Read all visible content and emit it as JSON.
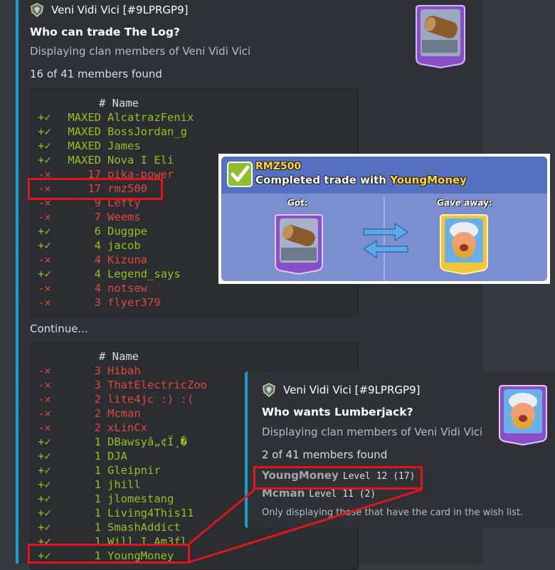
{
  "clan_embed": {
    "author": "Veni Vidi Vici [#9LPRGP9]",
    "title": "Who can trade The Log?",
    "description": "Displaying clan members of Veni Vidi Vici",
    "found": "16 of 41 members found",
    "header": "# Name",
    "rows": [
      {
        "sym": "+✓",
        "level": "MAXED",
        "name": "AlcatrazFenix",
        "ok": true
      },
      {
        "sym": "+✓",
        "level": "MAXED",
        "name": "BossJordan_g",
        "ok": true
      },
      {
        "sym": "+✓",
        "level": "MAXED",
        "name": "James",
        "ok": true
      },
      {
        "sym": "+✓",
        "level": "MAXED",
        "name": "Nova I Eli",
        "ok": true
      },
      {
        "sym": "-✕",
        "level": "17",
        "name": "pika-power",
        "ok": false
      },
      {
        "sym": "-✕",
        "level": "17",
        "name": "rmz500",
        "ok": false
      },
      {
        "sym": "-✕",
        "level": "9",
        "name": "Lefty",
        "ok": false
      },
      {
        "sym": "-✕",
        "level": "7",
        "name": "Weems",
        "ok": false
      },
      {
        "sym": "+✓",
        "level": "6",
        "name": "Duggpe",
        "ok": true
      },
      {
        "sym": "+✓",
        "level": "4",
        "name": "jacob",
        "ok": true
      },
      {
        "sym": "-✕",
        "level": "4",
        "name": "Kizuna",
        "ok": false
      },
      {
        "sym": "+✓",
        "level": "4",
        "name": "Legend_says",
        "ok": true
      },
      {
        "sym": "-✕",
        "level": "4",
        "name": "notsew",
        "ok": false
      },
      {
        "sym": "-✕",
        "level": "3",
        "name": "flyer379",
        "ok": false
      }
    ],
    "continue_label": "Continue...",
    "rows2": [
      {
        "sym": "-✕",
        "level": "3",
        "name": "Hibah",
        "ok": false
      },
      {
        "sym": "-✕",
        "level": "3",
        "name": "ThatElectricZoo",
        "ok": false
      },
      {
        "sym": "-✕",
        "level": "2",
        "name": "lite4jc :) :(",
        "ok": false
      },
      {
        "sym": "-✕",
        "level": "2",
        "name": "Mcman",
        "ok": false
      },
      {
        "sym": "-✕",
        "level": "2",
        "name": "xLinCx",
        "ok": false
      },
      {
        "sym": "+✓",
        "level": "1",
        "name": "DBawsyâ„¢Ï¸�",
        "ok": true
      },
      {
        "sym": "+✓",
        "level": "1",
        "name": "DJA",
        "ok": true
      },
      {
        "sym": "+✓",
        "level": "1",
        "name": "Gleipnir",
        "ok": true
      },
      {
        "sym": "+✓",
        "level": "1",
        "name": "jhill",
        "ok": true
      },
      {
        "sym": "+✓",
        "level": "1",
        "name": "jlomestang",
        "ok": true
      },
      {
        "sym": "+✓",
        "level": "1",
        "name": "Living4This11",
        "ok": true
      },
      {
        "sym": "+✓",
        "level": "1",
        "name": "SmashAddict",
        "ok": true
      },
      {
        "sym": "+✓",
        "level": "1",
        "name": "Will I Am3fl",
        "ok": true
      },
      {
        "sym": "+✓",
        "level": "1",
        "name": "YoungMoney",
        "ok": true
      }
    ]
  },
  "trade_card": {
    "user": "RMZ500",
    "text_prefix": "Completed trade with ",
    "partner": "YoungMoney",
    "got_label": "Got:",
    "gave_label": "Gave away:"
  },
  "wish_embed": {
    "author": "Veni Vidi Vici [#9LPRGP9]",
    "title": "Who wants Lumberjack?",
    "description": "Displaying clan members of Veni Vidi Vici",
    "found": "2 of 41 members found",
    "members": [
      {
        "name": "YoungMoney",
        "level": "Level 12 (17)"
      },
      {
        "name": "Mcman",
        "level": "Level 11 (2)"
      }
    ],
    "note": "Only displaying those that have the card in the wish list."
  },
  "colors": {
    "accent_bar": "#1aa0c7",
    "ok": "#94c121",
    "fail": "#dc4a3e",
    "highlight": "#e0151d"
  }
}
